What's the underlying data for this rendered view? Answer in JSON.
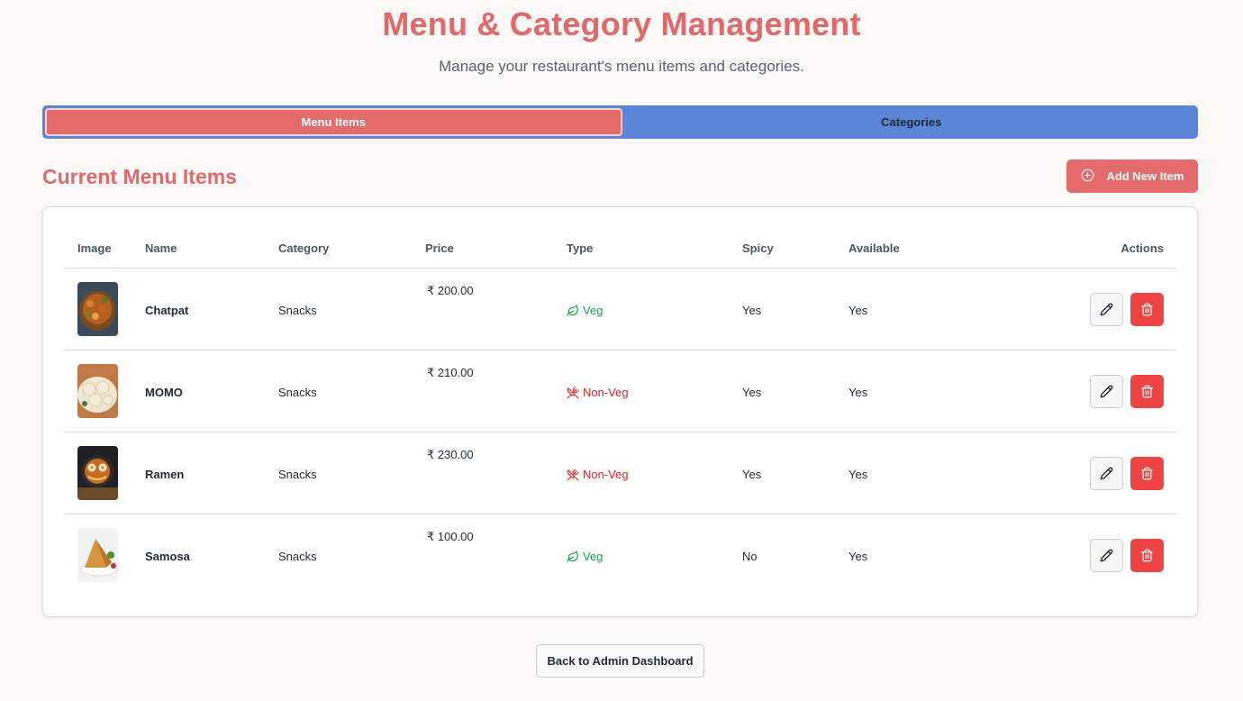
{
  "header": {
    "title": "Menu & Category Management",
    "subtitle": "Manage your restaurant's menu items and categories."
  },
  "tabs": [
    {
      "label": "Menu Items",
      "active": true
    },
    {
      "label": "Categories",
      "active": false
    }
  ],
  "section": {
    "title": "Current Menu Items",
    "add_button_label": "Add New Item",
    "add_button_icon": "plus-circle-icon"
  },
  "table": {
    "columns": [
      "Image",
      "Name",
      "Category",
      "Price",
      "Type",
      "Spicy",
      "Available",
      "Actions"
    ],
    "rows": [
      {
        "name": "Chatpat",
        "category": "Snacks",
        "price": "₹ 200.00",
        "type": "Veg",
        "spicy": "Yes",
        "available": "Yes"
      },
      {
        "name": "MOMO",
        "category": "Snacks",
        "price": "₹ 210.00",
        "type": "Non-Veg",
        "spicy": "Yes",
        "available": "Yes"
      },
      {
        "name": "Ramen",
        "category": "Snacks",
        "price": "₹ 230.00",
        "type": "Non-Veg",
        "spicy": "Yes",
        "available": "Yes"
      },
      {
        "name": "Samosa",
        "category": "Snacks",
        "price": "₹ 100.00",
        "type": "Veg",
        "spicy": "No",
        "available": "Yes"
      }
    ]
  },
  "footer": {
    "back_button_label": "Back to Admin Dashboard"
  },
  "colors": {
    "accent": "#e56a6a",
    "tab_inactive": "#5b85d6",
    "veg": "#16a34a",
    "non_veg": "#dc2626",
    "delete": "#ef4444"
  }
}
